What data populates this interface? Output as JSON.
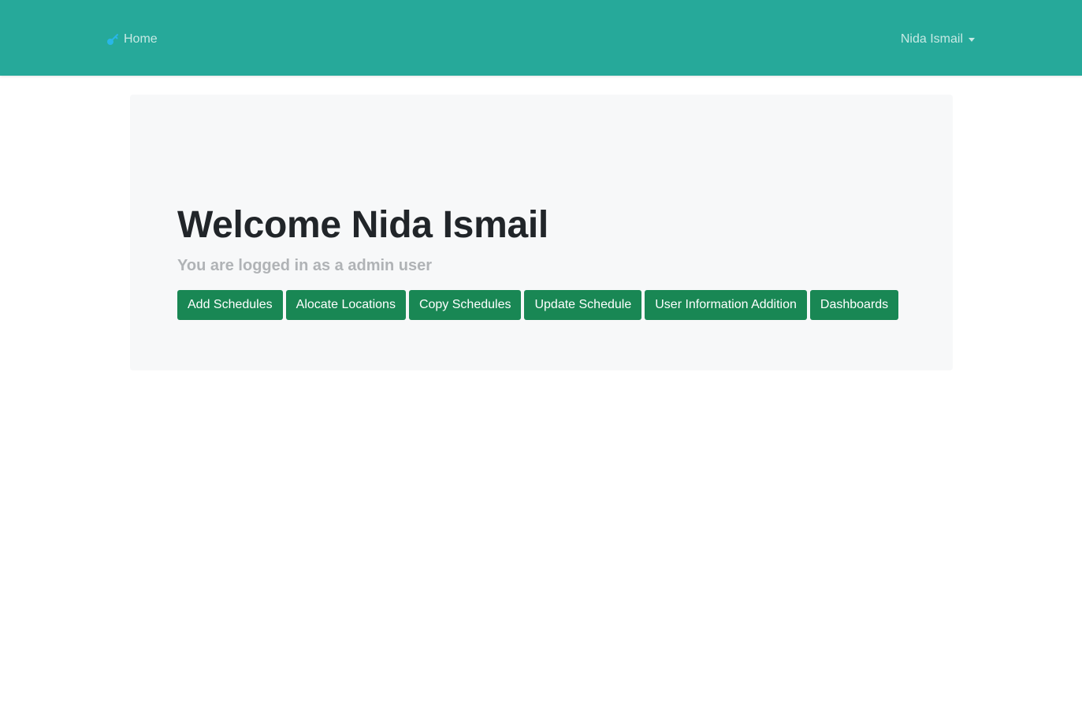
{
  "navbar": {
    "brand_label": "Home",
    "brand_icon": "key-icon",
    "user_name": "Nida Ismail",
    "background_color": "#26a99a"
  },
  "hero": {
    "title": "Welcome Nida Ismail",
    "subtitle": "You are logged in as a admin user"
  },
  "actions": [
    {
      "label": "Add Schedules"
    },
    {
      "label": "Alocate Locations"
    },
    {
      "label": "Copy Schedules"
    },
    {
      "label": "Update Schedule"
    },
    {
      "label": "User Information Addition"
    },
    {
      "label": "Dashboards"
    }
  ],
  "colors": {
    "accent": "#26a99a",
    "button": "#198754"
  }
}
